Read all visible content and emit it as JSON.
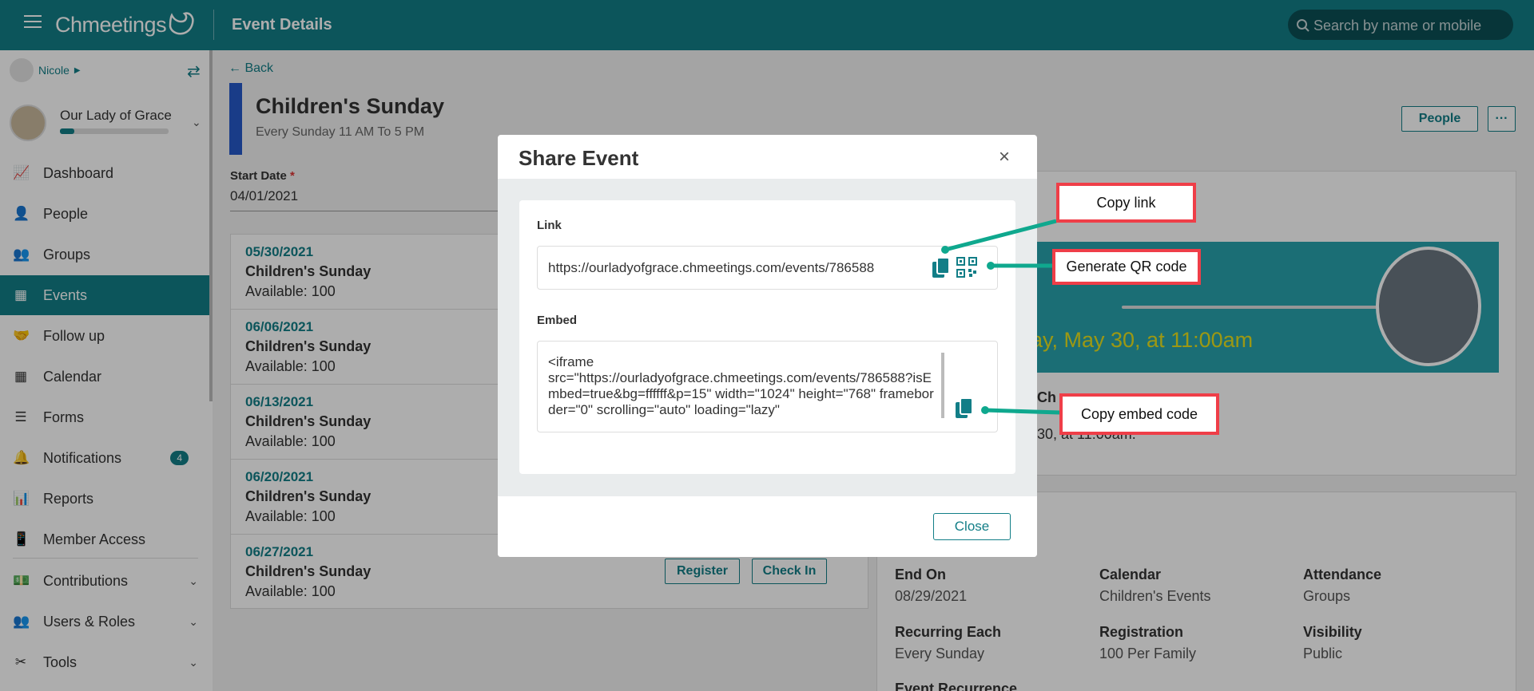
{
  "header": {
    "app_name": "Chmeetings",
    "page_title": "Event Details",
    "search_placeholder": "Search by name or mobile"
  },
  "sidebar": {
    "user_name": "Nicole",
    "org_name": "Our Lady of Grace",
    "items": [
      {
        "label": "Dashboard",
        "icon": "chart-line-icon"
      },
      {
        "label": "People",
        "icon": "person-icon"
      },
      {
        "label": "Groups",
        "icon": "users-icon"
      },
      {
        "label": "Events",
        "icon": "calendar-icon",
        "active": true
      },
      {
        "label": "Follow up",
        "icon": "handshake-icon"
      },
      {
        "label": "Calendar",
        "icon": "calendar-grid-icon"
      },
      {
        "label": "Forms",
        "icon": "list-icon"
      },
      {
        "label": "Notifications",
        "icon": "bell-icon",
        "badge": "4"
      },
      {
        "label": "Reports",
        "icon": "bar-chart-icon"
      },
      {
        "label": "Member Access",
        "icon": "mobile-icon"
      },
      {
        "label": "Contributions",
        "icon": "money-icon"
      },
      {
        "label": "Users & Roles",
        "icon": "users-cog-icon"
      },
      {
        "label": "Tools",
        "icon": "tools-icon"
      }
    ]
  },
  "event": {
    "back_label": "Back",
    "title": "Children's Sunday",
    "schedule": "Every Sunday 11 AM To 5 PM",
    "people_button": "People",
    "more_button": "···",
    "start_date_label": "Start Date",
    "start_date_required": "*",
    "start_date_value": "04/01/2021",
    "occurrences": [
      {
        "date": "05/30/2021",
        "name": "Children's Sunday",
        "available": "Available: 100"
      },
      {
        "date": "06/06/2021",
        "name": "Children's Sunday",
        "available": "Available: 100"
      },
      {
        "date": "06/13/2021",
        "name": "Children's Sunday",
        "available": "Available: 100"
      },
      {
        "date": "06/20/2021",
        "name": "Children's Sunday",
        "available": "Available: 100"
      },
      {
        "date": "06/27/2021",
        "name": "Children's Sunday",
        "available": "Available: 100"
      }
    ],
    "register_button": "Register",
    "checkin_button": "Check In",
    "banner_text": "lay, May 30, at 11:00am",
    "peek_heading": "Ch",
    "peek_text": "30, at 11:00am.",
    "details": [
      {
        "label": "End On",
        "value": "08/29/2021"
      },
      {
        "label": "Calendar",
        "value": "Children's Events"
      },
      {
        "label": "Attendance",
        "value": "Groups"
      },
      {
        "label": "Recurring Each",
        "value": "Every Sunday"
      },
      {
        "label": "Registration",
        "value": "100 Per Family"
      },
      {
        "label": "Visibility",
        "value": "Public"
      }
    ],
    "recurrence_label": "Event Recurrence"
  },
  "modal": {
    "title": "Share Event",
    "close_x": "×",
    "link_label": "Link",
    "link_value": "https://ourladyofgrace.chmeetings.com/events/786588",
    "embed_label": "Embed",
    "embed_value": "<iframe\nsrc=\"https://ourladyofgrace.chmeetings.com/events/786588?isEmbed=true&bg=ffffff&p=15\" width=\"1024\" height=\"768\" frameborder=\"0\" scrolling=\"auto\" loading=\"lazy\"",
    "close_button": "Close"
  },
  "annotations": {
    "copy_link": "Copy link",
    "generate_qr": "Generate QR code",
    "copy_embed": "Copy embed code"
  },
  "colors": {
    "brand": "#127e87",
    "callout_border": "#ef3e48",
    "connector": "#0fa88e"
  }
}
